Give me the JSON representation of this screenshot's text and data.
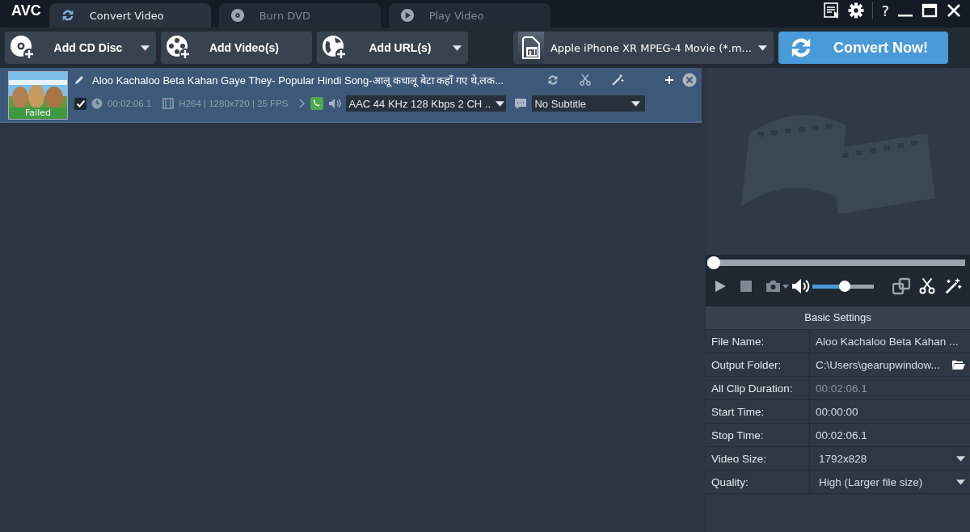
{
  "app_logo": "AVC",
  "help": "?",
  "tabs": [
    {
      "label": "Convert Video",
      "selected": true
    },
    {
      "label": "Burn DVD",
      "selected": false
    },
    {
      "label": "Play Video",
      "selected": false
    }
  ],
  "toolbar": {
    "buttons": [
      {
        "label": "Add CD Disc",
        "dropdown": true
      },
      {
        "label": "Add Video(s)",
        "dropdown": false
      },
      {
        "label": "Add URL(s)",
        "dropdown": true
      }
    ],
    "profile": "Apple iPhone XR MPEG-4 Movie (*.m...",
    "convert": "Convert Now!"
  },
  "files": [
    {
      "title": "Aloo Kachaloo Beta Kahan Gaye They- Popular Hindi Song-आलू कचालू बेटा कहाँ गए थे,लक...",
      "status": "Failed",
      "checked": true,
      "selected": true,
      "duration": "00:02:06.1",
      "video_info": "H264 | 1280x720 | 25 FPS",
      "audio": "AAC 44 KHz 128 Kbps 2 CH ..",
      "subtitle": "No Subtitle"
    }
  ],
  "player": {
    "seek": {
      "level": 0
    },
    "volume": {
      "level": 0.53
    }
  },
  "settings": {
    "title": "Basic Settings",
    "rows": [
      {
        "label": "File Name:",
        "value": "Aloo Kachaloo Beta Kahan ...",
        "kind": "text"
      },
      {
        "label": "Output Folder:",
        "value": "C:\\Users\\gearupwindow...",
        "kind": "folder"
      },
      {
        "label": "All Clip Duration:",
        "value": "00:02:06.1",
        "kind": "readonly"
      },
      {
        "label": "Start Time:",
        "value": "00:00:00",
        "kind": "text"
      },
      {
        "label": "Stop Time:",
        "value": "00:02:06.1",
        "kind": "text"
      },
      {
        "label": "Video Size:",
        "value": "1792x828",
        "kind": "dropdown"
      },
      {
        "label": "Quality:",
        "value": "High (Larger file size)",
        "kind": "dropdown"
      }
    ]
  }
}
